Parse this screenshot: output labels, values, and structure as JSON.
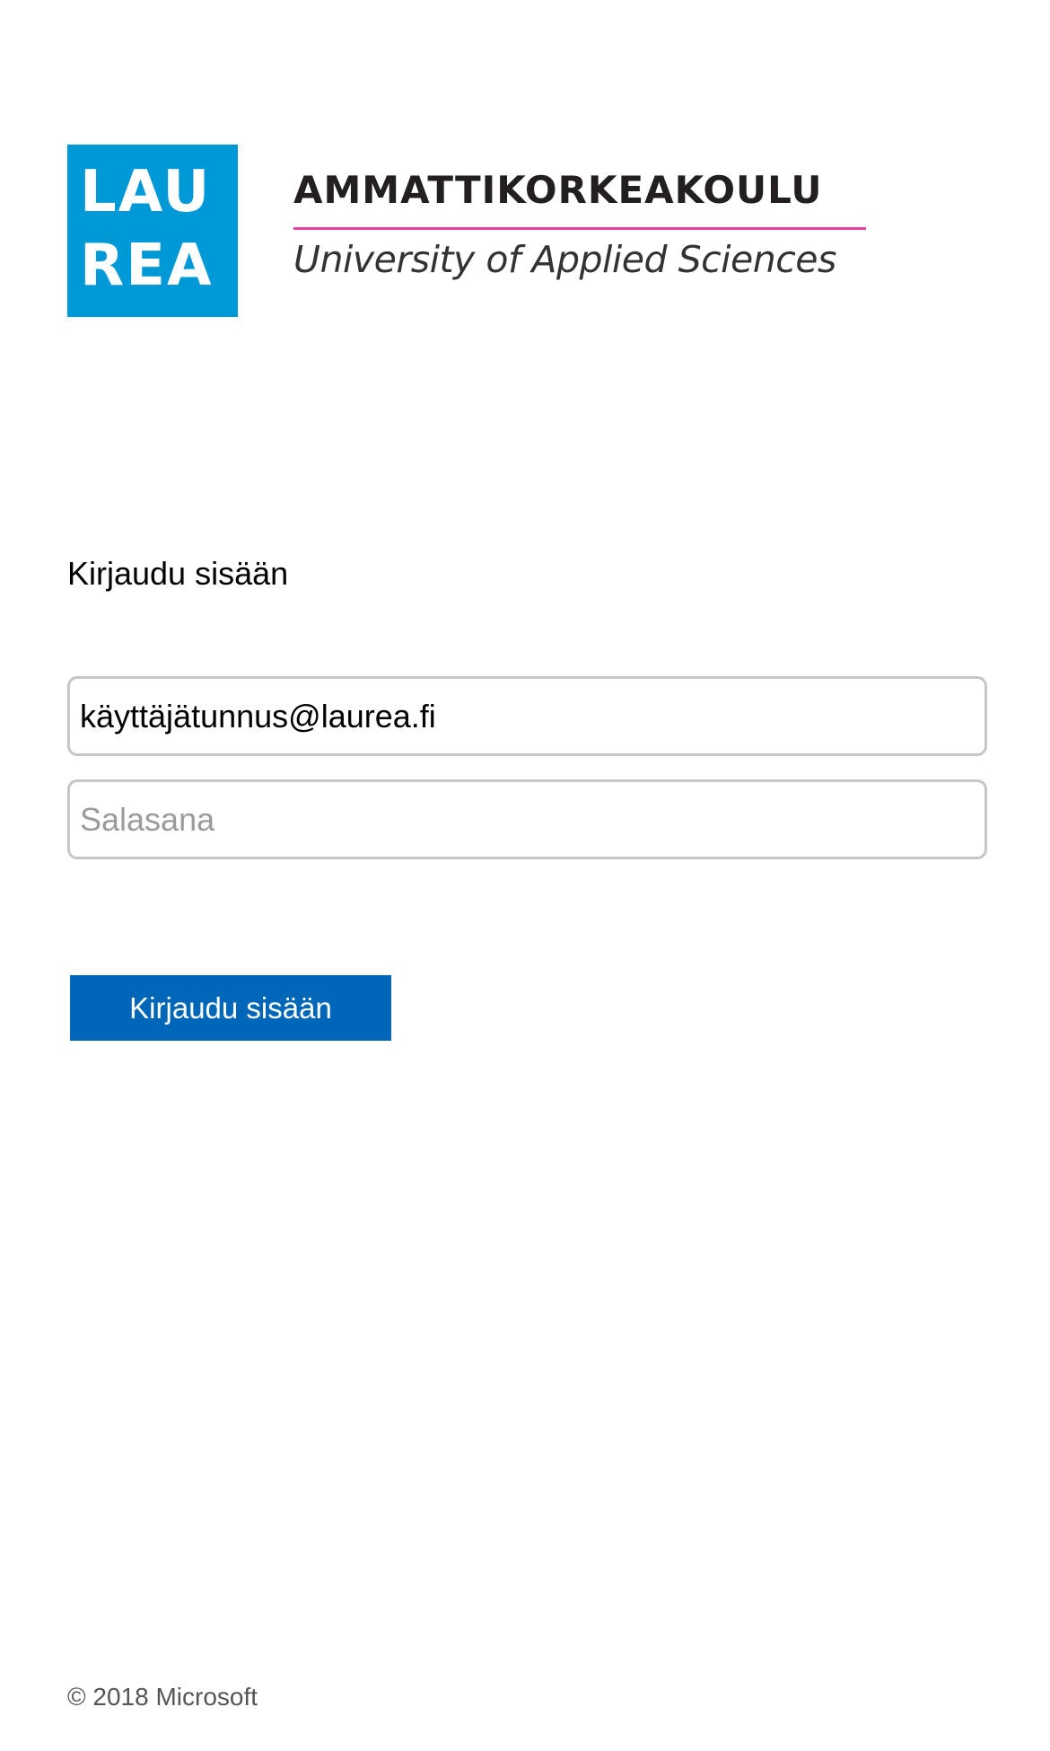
{
  "logo": {
    "square_line1": "LAU",
    "square_line2": "REA",
    "wordmark_line1": "AMMATTIKORKEAKOULU",
    "wordmark_line2": "University of Applied Sciences",
    "brand_color": "#0099d8",
    "rule_color": "#e6007e"
  },
  "login": {
    "heading": "Kirjaudu sisään",
    "username_value": "käyttäjätunnus@laurea.fi",
    "password_placeholder": "Salasana",
    "submit_label": "Kirjaudu sisään",
    "button_color": "#0067b8"
  },
  "footer": {
    "copyright": "© 2018 Microsoft"
  }
}
